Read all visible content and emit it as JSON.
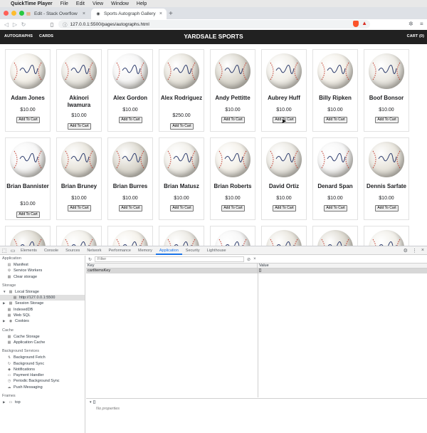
{
  "menubar": {
    "app": "QuickTime Player",
    "items": [
      "File",
      "Edit",
      "View",
      "Window",
      "Help"
    ]
  },
  "tabs": [
    {
      "title": "Edit - Stack Overflow"
    },
    {
      "title": "Sports Autograph Gallery"
    }
  ],
  "address": {
    "url": "127.0.0.1:5500/pages/autographs.html"
  },
  "site": {
    "nav_left": [
      "AUTOGRAPHS",
      "CARDS"
    ],
    "brand": "YARDSALE SPORTS",
    "cart": "CART (0)"
  },
  "colors": {
    "nav_bg": "#212121",
    "devtools_accent": "#1a73e8",
    "brave_shield": "#fb542b"
  },
  "products": [
    {
      "name": "Adam Jones",
      "price": "$10.00",
      "button": "Add To Cart"
    },
    {
      "name": "Akinori Iwamura",
      "price": "$10.00",
      "button": "Add To Cart"
    },
    {
      "name": "Alex Gordon",
      "price": "$10.00",
      "button": "Add To Cart"
    },
    {
      "name": "Alex Rodriguez",
      "price": "$250.00",
      "button": "Add To Cart"
    },
    {
      "name": "Andy Pettitte",
      "price": "$10.00",
      "button": "Add To Cart"
    },
    {
      "name": "Aubrey Huff",
      "price": "$10.00",
      "button": "Add To Cart"
    },
    {
      "name": "Billy Ripken",
      "price": "$10.00",
      "button": "Add To Cart"
    },
    {
      "name": "Boof Bonsor",
      "price": "$10.00",
      "button": "Add To Cart"
    },
    {
      "name": "Brian Bannister",
      "price": "$10.00",
      "button": "Add To Cart"
    },
    {
      "name": "Brian Bruney",
      "price": "$10.00",
      "button": "Add To Cart"
    },
    {
      "name": "Brian Burres",
      "price": "$10.00",
      "button": "Add To Cart"
    },
    {
      "name": "Brian Matusz",
      "price": "$10.00",
      "button": "Add To Cart"
    },
    {
      "name": "Brian Roberts",
      "price": "$10.00",
      "button": "Add To Cart"
    },
    {
      "name": "David Ortiz",
      "price": "$10.00",
      "button": "Add To Cart"
    },
    {
      "name": "Denard Span",
      "price": "$10.00",
      "button": "Add To Cart"
    },
    {
      "name": "Dennis Sarfate",
      "price": "$10.00",
      "button": "Add To Cart"
    }
  ],
  "devtools": {
    "tabs": [
      "Elements",
      "Console",
      "Sources",
      "Network",
      "Performance",
      "Memory",
      "Application",
      "Security",
      "Lighthouse"
    ],
    "active_tab": "Application",
    "sidebar": {
      "application": {
        "heading": "Application",
        "items": [
          "Manifest",
          "Service Workers",
          "Clear storage"
        ]
      },
      "storage": {
        "heading": "Storage",
        "local_storage": "Local Storage",
        "local_origin": "http://127.0.0.1:5500",
        "items": [
          "Session Storage",
          "IndexedDB",
          "Web SQL",
          "Cookies"
        ]
      },
      "cache": {
        "heading": "Cache",
        "items": [
          "Cache Storage",
          "Application Cache"
        ]
      },
      "background": {
        "heading": "Background Services",
        "items": [
          "Background Fetch",
          "Background Sync",
          "Notifications",
          "Payment Handler",
          "Periodic Background Sync",
          "Push Messaging"
        ]
      },
      "frames": {
        "heading": "Frames",
        "items": [
          "top"
        ]
      }
    },
    "filter_placeholder": "Filter",
    "table": {
      "key_header": "Key",
      "value_header": "Value",
      "rows": [
        {
          "key": "cartItemsKey",
          "value": "[]"
        }
      ]
    },
    "preview": {
      "value": "[]",
      "empty": "No properties"
    }
  }
}
